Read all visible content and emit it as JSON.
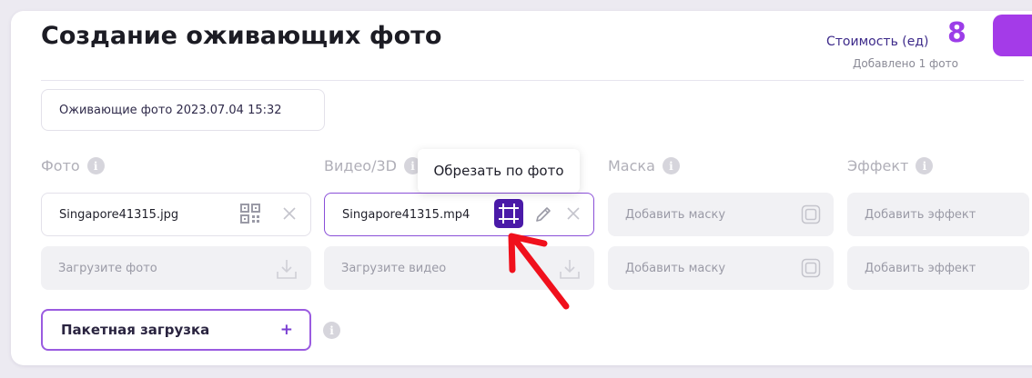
{
  "page": {
    "title": "Создание оживающих фото"
  },
  "cost": {
    "label": "Стоимость (ед)",
    "value": "8",
    "subtitle": "Добавлено 1 фото"
  },
  "project_name": {
    "value": "Оживающие фото 2023.07.04 15:32"
  },
  "columns": {
    "photo": {
      "label": "Фото",
      "info_icon": "info-icon"
    },
    "video": {
      "label": "Видео/3D",
      "info_icon": "info-icon"
    },
    "mask": {
      "label": "Маска",
      "info_icon": "info-icon"
    },
    "effect": {
      "label": "Эффект",
      "info_icon": "info-icon"
    }
  },
  "row1": {
    "photo_file": "Singapore41315.jpg",
    "video_file": "Singapore41315.mp4",
    "mask": "Добавить маску",
    "effect": "Добавить эффект"
  },
  "row2": {
    "photo": "Загрузите фото",
    "video": "Загрузите видео",
    "mask": "Добавить маску",
    "effect": "Добавить эффект"
  },
  "tooltip": {
    "text": "Обрезать по фото"
  },
  "batch": {
    "label": "Пакетная загрузка",
    "plus": "+"
  },
  "info_glyph": "i",
  "colors": {
    "accent": "#9c3de8",
    "crop_button": "#4a1aa8",
    "annotation_arrow": "#f0101c",
    "batch_border": "#9a5be0"
  },
  "icons": [
    "qr-code-icon",
    "close-icon",
    "crop-icon",
    "pencil-icon",
    "upload-icon",
    "mask-frame-icon",
    "info-icon",
    "annotation-arrow"
  ]
}
